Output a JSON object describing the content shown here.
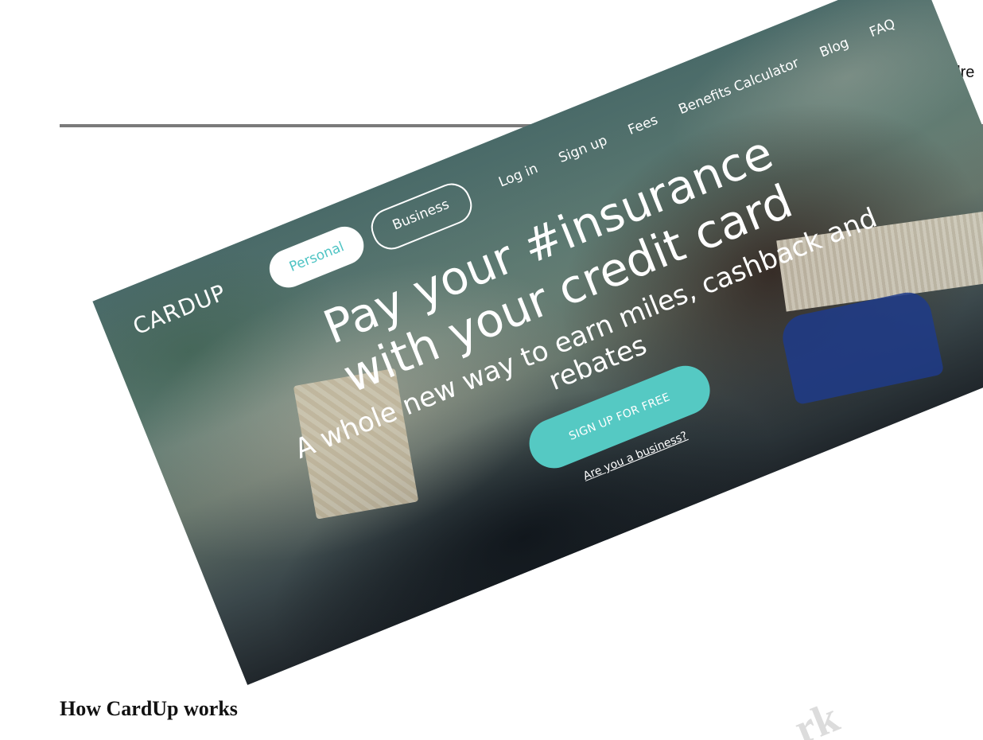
{
  "header": {
    "address_label": "Addre"
  },
  "hero": {
    "logo": "CARDUP",
    "tabs": [
      {
        "label": "Personal",
        "active": true
      },
      {
        "label": "Business",
        "active": false
      }
    ],
    "nav": [
      "Log in",
      "Sign up",
      "Fees",
      "Benefits Calculator",
      "Blog",
      "FAQ"
    ],
    "headline_line1": "Pay your #insurance",
    "headline_line2": "with your credit card",
    "subline_line1": "A whole new way to earn miles, cashback and",
    "subline_line2": "rebates",
    "cta_label": "SIGN UP FOR FREE",
    "business_link": "Are you a business?"
  },
  "section": {
    "how_it_works_heading": "How CardUp works",
    "ghost_text": "rk"
  },
  "colors": {
    "accent": "#55c9c3",
    "personal_text": "#4fc4c4",
    "divider": "#7a7a7a"
  }
}
